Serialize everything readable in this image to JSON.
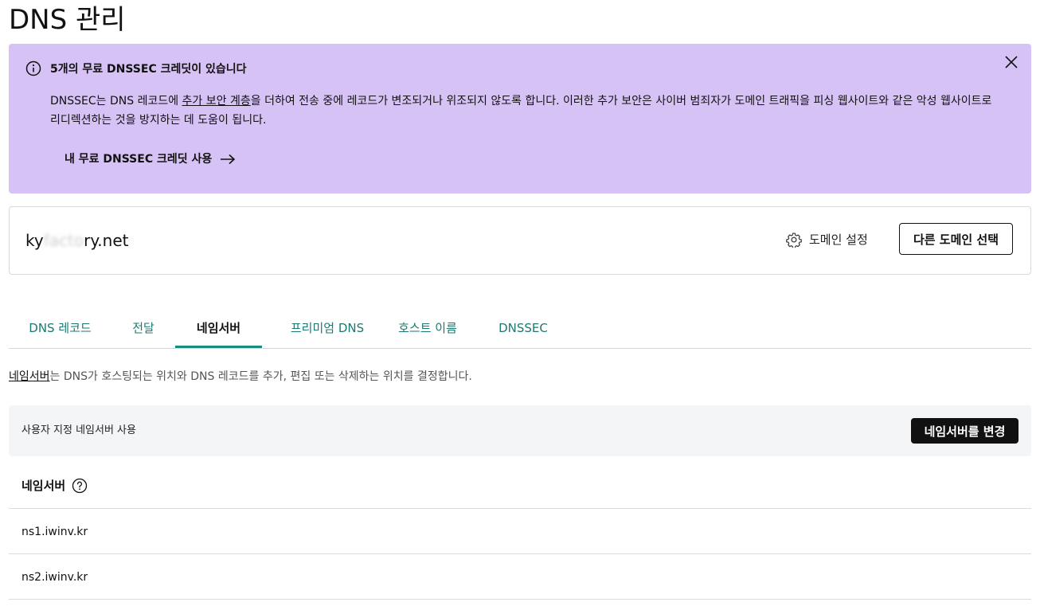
{
  "page": {
    "title": "DNS 관리"
  },
  "banner": {
    "title": "5개의 무료 DNSSEC 크레딧이 있습니다",
    "body_pre": "DNSSEC는 DNS 레코드에 ",
    "body_link": "추가 보안 계층",
    "body_post": "을 더하여 전송 중에 레코드가 변조되거나 위조되지 않도록 합니다. 이러한 추가 보안은 사이버 범죄자가 도메인 트래픽을 피싱 웹사이트와 같은 악성 웹사이트로 리디렉션하는 것을 방지하는 데 도움이 됩니다.",
    "cta": "내 무료 DNSSEC 크레딧 사용",
    "cta_icon": "arrow-right-icon",
    "close_icon": "close-icon",
    "info_icon": "info-icon",
    "bg_color": "#d7c2f5"
  },
  "domain": {
    "name_start": "ky",
    "name_redacted": "facto",
    "name_end": "ry.net",
    "settings_label": "도메인 설정",
    "settings_icon": "gear-icon",
    "select_label": "다른 도메인 선택"
  },
  "tabs": [
    {
      "label": "DNS 레코드"
    },
    {
      "label": "전달"
    },
    {
      "label": "네임서버"
    },
    {
      "label": "프리미엄 DNS"
    },
    {
      "label": "호스트 이름"
    },
    {
      "label": "DNSSEC"
    }
  ],
  "active_tab": "네임서버",
  "description": {
    "link": "네임서버",
    "text": "는 DNS가 호스팅되는 위치와 DNS 레코드를 추가, 편집 또는 삭제하는 위치를 결정합니다."
  },
  "nameserver_mode": {
    "label": "사용자 지정 네임서버 사용",
    "button": "네임서버를 변경"
  },
  "nameservers": {
    "header": "네임서버",
    "help_icon": "help-icon",
    "items": [
      "ns1.iwinv.kr",
      "ns2.iwinv.kr"
    ]
  },
  "colors": {
    "accent_teal": "#1a8b7f",
    "tab_text": "#1a7a72",
    "primary_button": "#111111"
  }
}
